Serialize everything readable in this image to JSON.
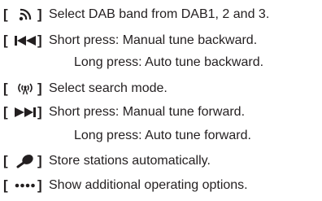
{
  "items": [
    {
      "icon": "dab-band-icon",
      "text": "Select DAB band from DAB1, 2 and 3."
    },
    {
      "icon": "skip-backward-icon",
      "text": "Short press: Manual tune backward.",
      "text2": "Long press:  Auto tune backward."
    },
    {
      "icon": "search-mode-icon",
      "text": "Select search mode."
    },
    {
      "icon": "skip-forward-icon",
      "text": "Short press: Manual tune forward.",
      "text2": "Long press:  Auto tune forward."
    },
    {
      "icon": "microphone-icon",
      "text": "Store stations automatically."
    },
    {
      "icon": "more-options-icon",
      "text": "Show additional operating options."
    }
  ],
  "brackets": {
    "open": "[",
    "close": "]"
  }
}
